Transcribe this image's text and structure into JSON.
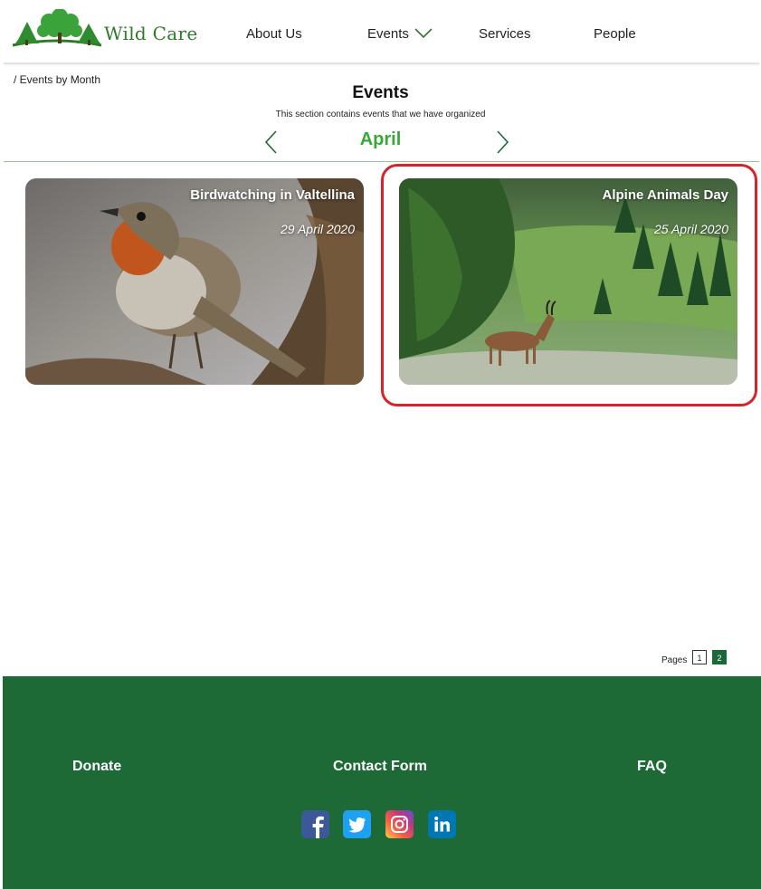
{
  "header": {
    "logo_text": "Wild Care",
    "nav": {
      "about": "About Us",
      "events": "Events",
      "services": "Services",
      "people": "People"
    }
  },
  "breadcrumb": "/ Events by Month",
  "page": {
    "title": "Events",
    "subtitle": "This section contains events that we have organized",
    "month": "April"
  },
  "events": [
    {
      "title": "Birdwatching in Valtellina",
      "date": "29 April 2020",
      "image": "robin-bird"
    },
    {
      "title": "Alpine Animals Day",
      "date": "25 April 2020",
      "image": "chamois-in-alpine-meadow",
      "highlighted": true
    }
  ],
  "pagination": {
    "label": "Pages",
    "pages": [
      "1",
      "2"
    ],
    "current": "2"
  },
  "footer": {
    "links": {
      "donate": "Donate",
      "contact": "Contact Form",
      "faq": "FAQ"
    },
    "social": [
      "facebook-icon",
      "twitter-icon",
      "instagram-icon",
      "linkedin-icon"
    ]
  },
  "colors": {
    "brand_green": "#1d6a36",
    "month_green": "#3ba73b",
    "highlight_red": "#d8232a"
  }
}
